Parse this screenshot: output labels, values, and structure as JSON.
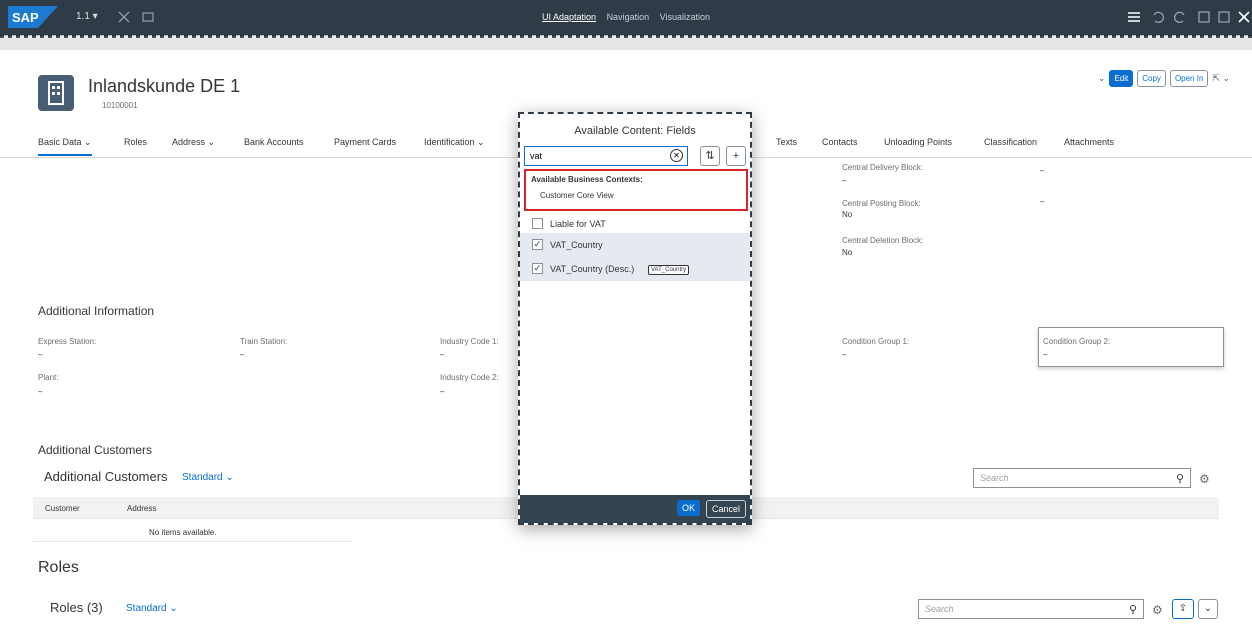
{
  "topbar": {
    "logo": "SAP",
    "version": "1.1 ▾",
    "tabs": [
      "UI Adaptation",
      "Navigation",
      "Visualization"
    ],
    "active_tab": "UI Adaptation"
  },
  "header": {
    "title": "Inlandskunde DE 1",
    "id": "10100001",
    "actions": {
      "edit": "Edit",
      "copy": "Copy",
      "open_in": "Open In"
    }
  },
  "tabs": [
    "Basic Data",
    "Roles",
    "Address",
    "Bank Accounts",
    "Payment Cards",
    "Identification",
    "Texts",
    "Contacts",
    "Unloading Points",
    "Classification",
    "Attachments"
  ],
  "blocks": {
    "central_delivery_label": "Central Delivery Block:",
    "central_delivery_value": "–",
    "central_posting_label": "Central Posting Block:",
    "central_posting_value": "No",
    "central_deletion_label": "Central Deletion Block:",
    "central_deletion_value": "No",
    "dash1": "–",
    "dash2": "–"
  },
  "additional_info": {
    "title": "Additional Information",
    "express_label": "Express Station:",
    "express_value": "–",
    "train_label": "Train Station:",
    "train_value": "–",
    "industry1_label": "Industry Code 1:",
    "industry1_value": "–",
    "industry2_label": "Industry Code 2:",
    "industry2_value": "–",
    "plant_label": "Plant:",
    "plant_value": "–",
    "cond1_label": "Condition Group 1:",
    "cond1_value": "–",
    "cond2_label": "Condition Group 2:",
    "cond2_value": "–"
  },
  "additional_customers": {
    "section_title": "Additional Customers",
    "table_title": "Additional Customers",
    "variant": "Standard",
    "col_customer": "Customer",
    "col_address": "Address",
    "empty": "No items available.",
    "search_placeholder": "Search"
  },
  "roles": {
    "section_title": "Roles",
    "table_title": "Roles (3)",
    "variant": "Standard",
    "search_placeholder": "Search"
  },
  "dialog": {
    "title": "Available Content: Fields",
    "search_value": "vat",
    "context_heading": "Available Business Contexts:",
    "context_item": "Customer Core View",
    "fields": [
      {
        "label": "Liable for VAT",
        "checked": ""
      },
      {
        "label": "VAT_Country",
        "checked": "✓"
      },
      {
        "label": "VAT_Country (Desc.)",
        "checked": "✓"
      }
    ],
    "tooltip": "VAT_Country",
    "ok": "OK",
    "cancel": "Cancel"
  }
}
